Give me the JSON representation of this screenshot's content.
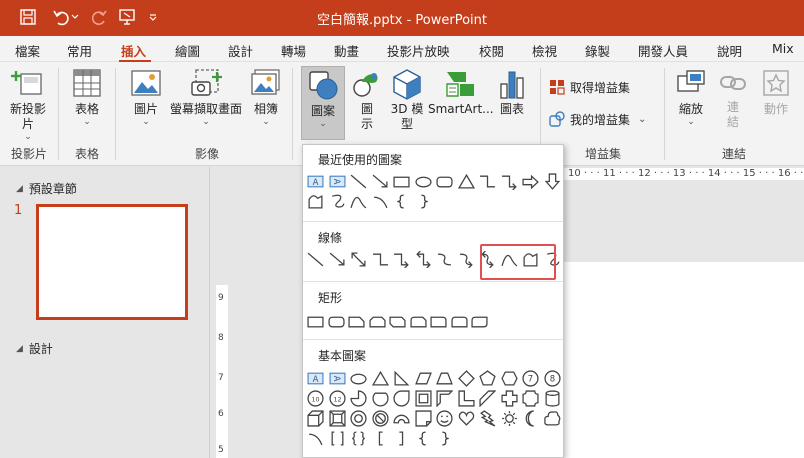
{
  "window": {
    "title": "空白簡報.pptx  -  PowerPoint",
    "accent": "#c43e1c"
  },
  "quick_access": [
    "save-icon",
    "undo-icon",
    "redo-icon",
    "presentation-icon",
    "customize-icon"
  ],
  "tabs": [
    {
      "label": "檔案"
    },
    {
      "label": "常用"
    },
    {
      "label": "插入"
    },
    {
      "label": "繪圖"
    },
    {
      "label": "設計"
    },
    {
      "label": "轉場"
    },
    {
      "label": "動畫"
    },
    {
      "label": "投影片放映"
    },
    {
      "label": "校閱"
    },
    {
      "label": "檢視"
    },
    {
      "label": "錄製"
    },
    {
      "label": "開發人員"
    },
    {
      "label": "說明"
    },
    {
      "label": "Mix"
    }
  ],
  "active_tab": "插入",
  "ribbon": {
    "new_slide": {
      "label1": "新投影",
      "label2": "片"
    },
    "table": {
      "label": "表格"
    },
    "pictures": {
      "label": "圖片"
    },
    "screenshot": {
      "label": "螢幕擷取畫面"
    },
    "album": {
      "label": "相簿"
    },
    "shapes": {
      "label": "圖案"
    },
    "icons": {
      "label1": "圖",
      "label2": "示"
    },
    "models3d": {
      "label1": "3D 模",
      "label2": "型"
    },
    "smartart": {
      "label": "SmartArt..."
    },
    "chart": {
      "label": "圖表"
    },
    "get_addins": {
      "label": "取得增益集"
    },
    "my_addins": {
      "label": "我的增益集"
    },
    "zoom": {
      "label": "縮放"
    },
    "link": {
      "label1": "連",
      "label2": "結"
    },
    "action": {
      "label": "動作"
    },
    "groups": {
      "slides": "投影片",
      "tables": "表格",
      "images": "影像",
      "addins": "增益集",
      "links": "連結"
    }
  },
  "left_pane": {
    "section1": "預設章節",
    "slide_number": "1",
    "section2": "設計"
  },
  "ruler": {
    "h_text": "10 · · · 11 · · · 12 · · · 13 · · · 14 · · · 15 · · · 16 · ·",
    "v_marks": [
      "9",
      "8",
      "7",
      "6",
      "5"
    ]
  },
  "shapes_menu": {
    "recent": {
      "title": "最近使用的圖案",
      "items": [
        "text-box-icon",
        "vertical-text-box-icon",
        "line-icon",
        "arrow-line-icon",
        "rectangle-icon",
        "oval-icon",
        "rounded-rectangle-icon",
        "triangle-icon",
        "elbow-connector-icon",
        "elbow-arrow-connector-icon",
        "right-arrow-icon",
        "down-arrow-icon",
        "freeform-shape-icon",
        "scribble-icon",
        "curve-icon",
        "arc-icon",
        "left-brace-icon",
        "right-brace-icon"
      ]
    },
    "lines": {
      "title": "線條",
      "items": [
        "line-icon",
        "arrow-line-icon",
        "double-arrow-line-icon",
        "elbow-connector-icon",
        "elbow-arrow-connector-icon",
        "elbow-double-arrow-icon",
        "curved-connector-icon",
        "curved-arrow-connector-icon",
        "curved-double-arrow-icon",
        "curve-icon",
        "freeform-shape-icon",
        "scribble-icon"
      ],
      "highlighted": [
        "curve-icon",
        "freeform-shape-icon",
        "scribble-icon"
      ]
    },
    "rect": {
      "title": "矩形",
      "items": [
        "rectangle-icon",
        "rounded-rectangle-icon",
        "snip-single-corner-icon",
        "snip-same-side-icon",
        "snip-diagonal-icon",
        "snip-round-icon",
        "round-single-corner-icon",
        "round-same-side-icon",
        "round-diagonal-icon"
      ]
    },
    "basic": {
      "title": "基本圖案",
      "row1": [
        "text-box-icon",
        "vertical-text-box-icon",
        "oval-icon",
        "triangle-icon",
        "right-triangle-icon",
        "parallelogram-icon",
        "trapezoid-icon",
        "diamond-icon",
        "pentagon-icon",
        "hexagon-icon",
        "heptagon-icon",
        "octagon-icon"
      ],
      "row1_labels": {
        "heptagon": "7",
        "octagon": "8"
      },
      "row2": [
        "decagon-icon",
        "dodecagon-icon",
        "pie-icon",
        "chord-icon",
        "teardrop-icon",
        "frame-icon",
        "half-frame-icon",
        "l-shape-icon",
        "diagonal-stripe-icon",
        "cross-icon",
        "plaque-icon",
        "can-icon"
      ],
      "row2_labels": {
        "decagon": "10",
        "dodecagon": "12"
      },
      "row3": [
        "cube-icon",
        "bevel-icon",
        "donut-icon",
        "no-symbol-icon",
        "block-arc-icon",
        "folded-corner-icon",
        "smiley-face-icon",
        "heart-icon",
        "lightning-bolt-icon",
        "sun-icon",
        "moon-icon",
        "cloud-icon"
      ],
      "row4": [
        "arc-icon",
        "double-bracket-icon",
        "double-brace-icon",
        "left-bracket-icon",
        "right-bracket-icon",
        "left-brace-icon",
        "right-brace-icon"
      ]
    }
  }
}
